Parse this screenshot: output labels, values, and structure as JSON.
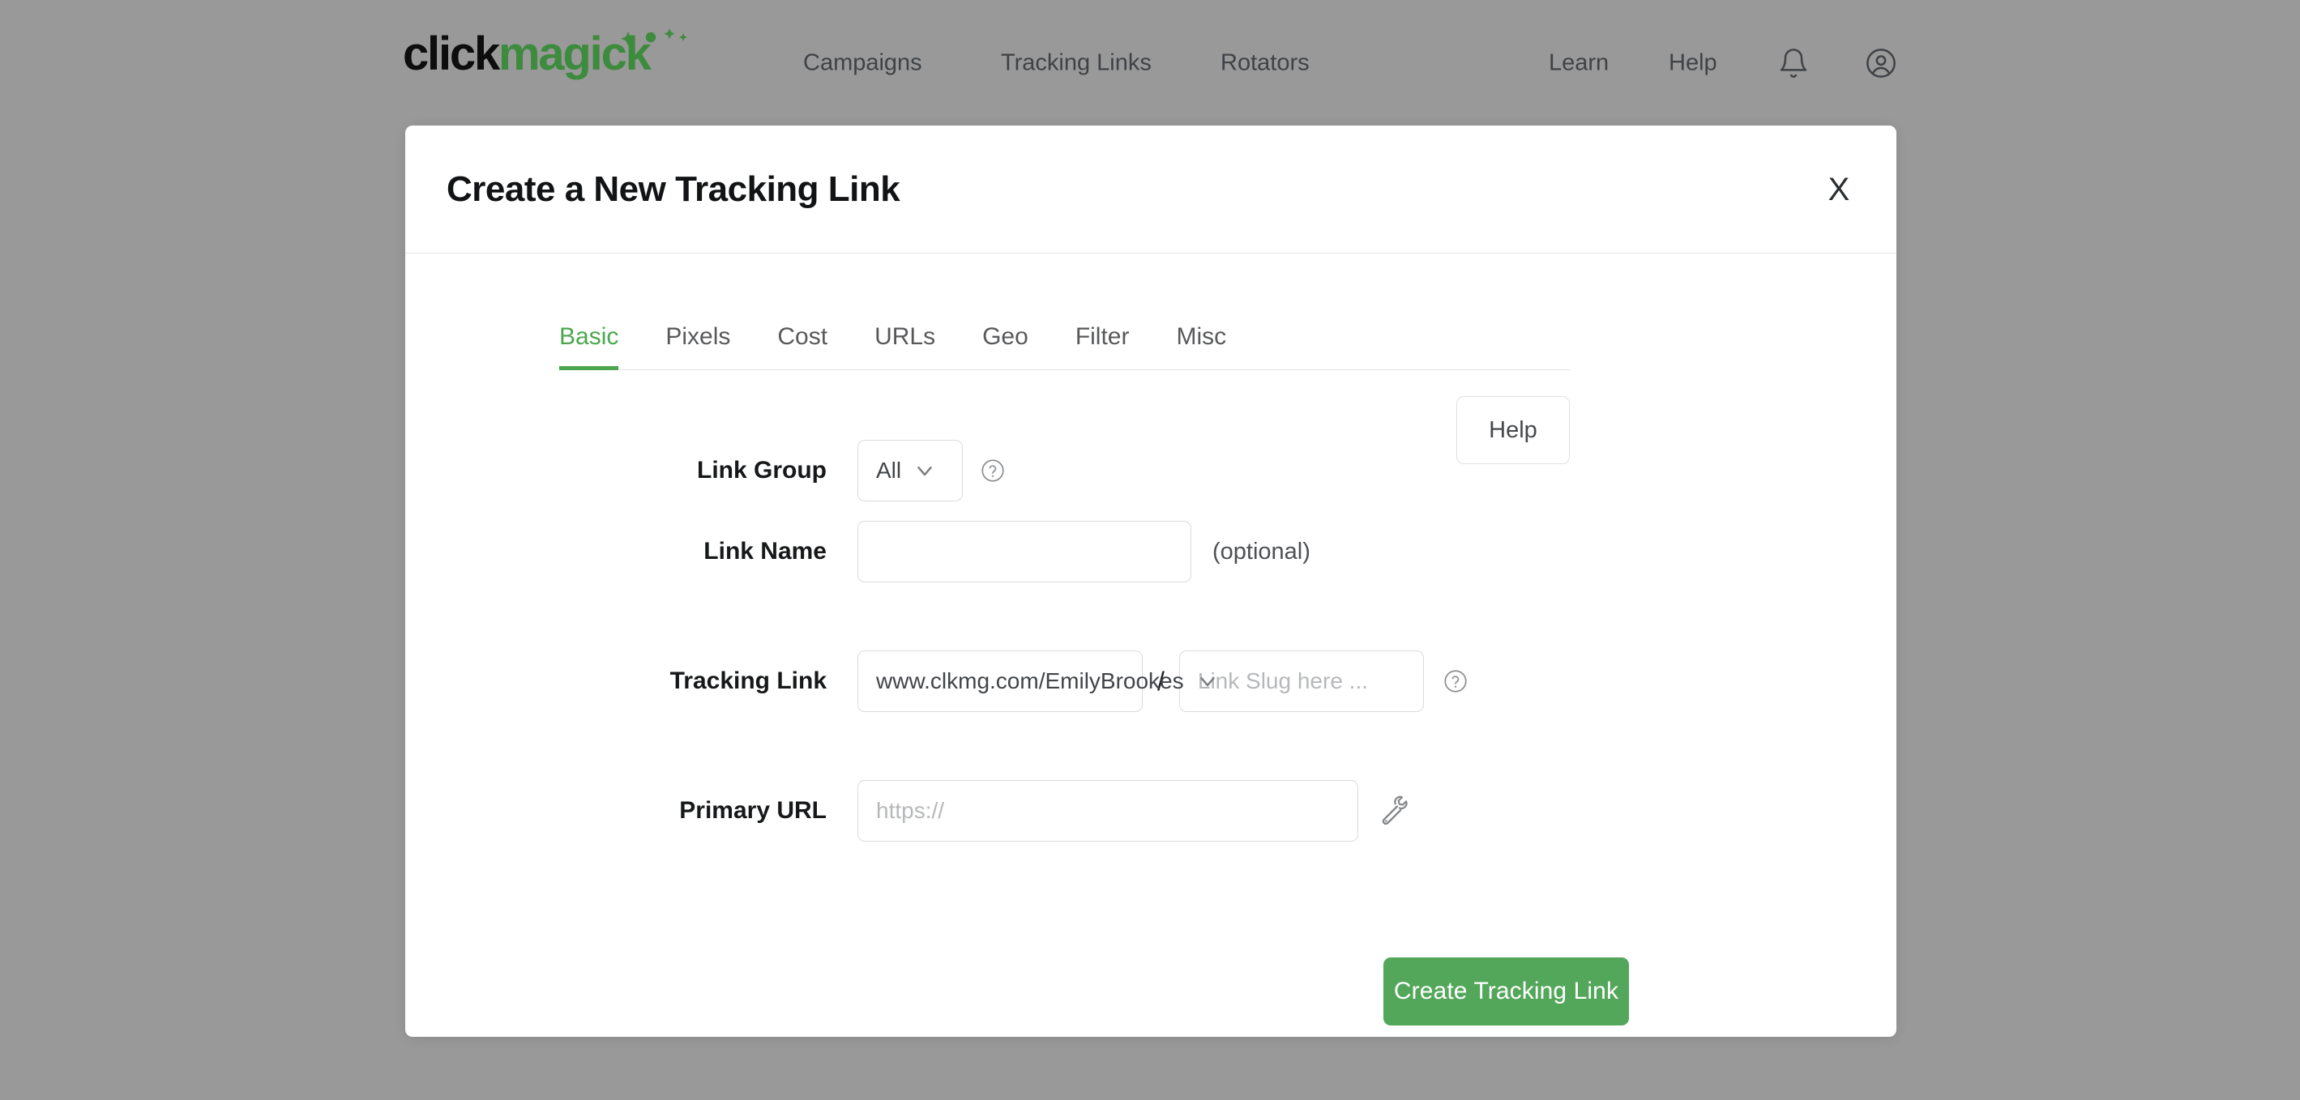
{
  "nav": {
    "logo": {
      "part1": "click",
      "part2": "magick",
      "sparkle_icon": "sparkles-icon"
    },
    "links": [
      {
        "id": "campaigns",
        "label": "Campaigns"
      },
      {
        "id": "tracking-links",
        "label": "Tracking Links"
      },
      {
        "id": "rotators",
        "label": "Rotators"
      },
      {
        "id": "learn",
        "label": "Learn"
      },
      {
        "id": "help",
        "label": "Help"
      }
    ],
    "icons": [
      {
        "id": "notifications",
        "name": "bell-icon"
      },
      {
        "id": "account",
        "name": "account-circle-icon"
      }
    ]
  },
  "modal": {
    "title": "Create a New Tracking Link",
    "close_label": "X",
    "tabs": [
      {
        "label": "Basic",
        "active": true
      },
      {
        "label": "Pixels",
        "active": false
      },
      {
        "label": "Cost",
        "active": false
      },
      {
        "label": "URLs",
        "active": false
      },
      {
        "label": "Geo",
        "active": false
      },
      {
        "label": "Filter",
        "active": false
      },
      {
        "label": "Misc",
        "active": false
      }
    ],
    "help_button": "Help",
    "fields": {
      "link_group": {
        "label": "Link Group",
        "value": "All",
        "help_icon": "question-circle-icon"
      },
      "link_name": {
        "label": "Link Name",
        "value": "",
        "placeholder": "",
        "hint": "(optional)"
      },
      "tracking_link": {
        "label": "Tracking Link",
        "domain": "www.clkmg.com/EmilyBrookes",
        "separator": "/",
        "slug_value": "",
        "slug_placeholder": "Link Slug here ...",
        "help_icon": "question-circle-icon"
      },
      "primary_url": {
        "label": "Primary URL",
        "value": "",
        "placeholder": "https://",
        "tool_icon": "wrench-icon"
      }
    },
    "submit_button": "Create Tracking Link"
  },
  "colors": {
    "accent_green": "#4ba74f",
    "button_green": "#53a75a",
    "logo_green": "#3d8b3d",
    "overlay_gray": "#999999"
  }
}
